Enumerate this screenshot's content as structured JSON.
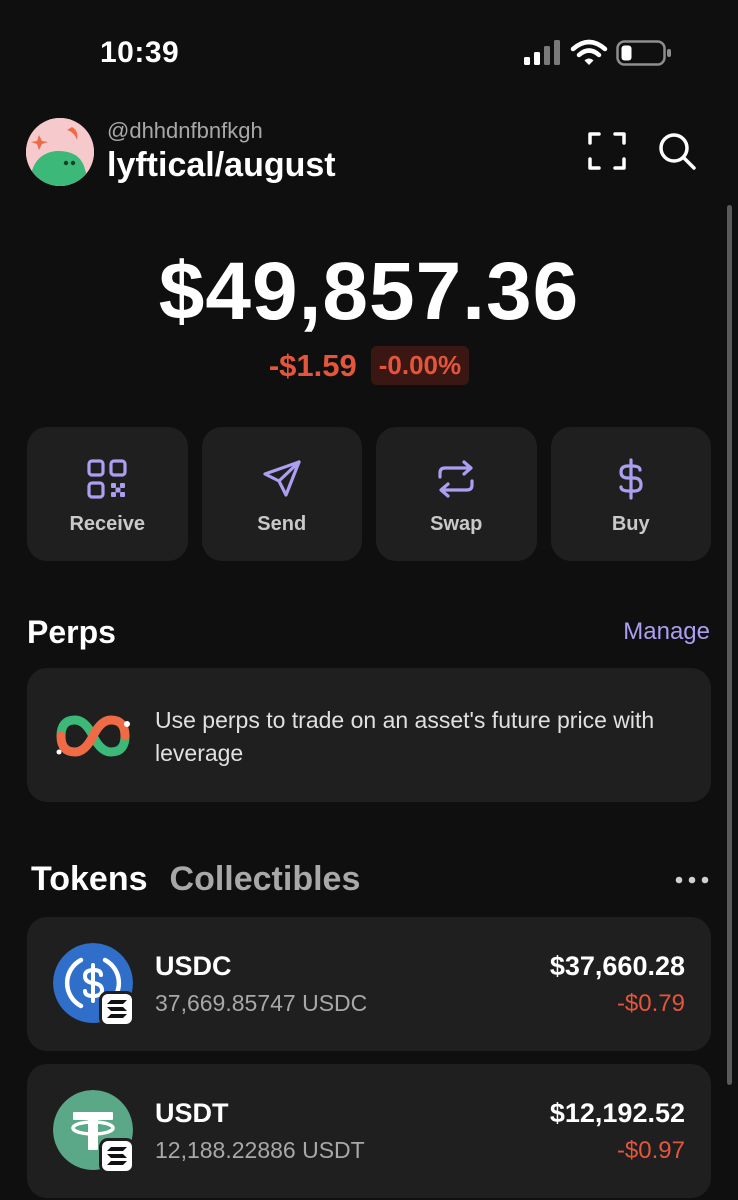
{
  "status_bar": {
    "time": "10:39",
    "signal_icon": "cellular-signal-icon",
    "wifi_icon": "wifi-icon",
    "battery_icon": "battery-low-icon"
  },
  "header": {
    "handle": "@dhhdnfbnfkgh",
    "account_name": "lyftical/august",
    "avatar_icon": "avatar-icon",
    "expand_icon": "expand-frame-icon",
    "search_icon": "search-icon"
  },
  "balance": {
    "total": "$49,857.36",
    "change_value": "-$1.59",
    "change_percent": "-0.00%"
  },
  "actions": [
    {
      "label": "Receive",
      "icon": "qr-code-icon"
    },
    {
      "label": "Send",
      "icon": "send-arrow-icon"
    },
    {
      "label": "Swap",
      "icon": "swap-arrows-icon"
    },
    {
      "label": "Buy",
      "icon": "dollar-icon"
    }
  ],
  "perps": {
    "title": "Perps",
    "manage_label": "Manage",
    "description": "Use perps to trade on an asset's future price with leverage",
    "icon": "perps-infinity-icon"
  },
  "tabs": {
    "tokens": "Tokens",
    "collectibles": "Collectibles",
    "more_icon": "more-dots-icon"
  },
  "tokens": [
    {
      "name": "USDC",
      "amount": "37,669.85747 USDC",
      "value": "$37,660.28",
      "change": "-$0.79",
      "logo": "usdc-logo-icon",
      "badge": "solana-badge-icon"
    },
    {
      "name": "USDT",
      "amount": "12,188.22886 USDT",
      "value": "$12,192.52",
      "change": "-$0.97",
      "logo": "usdt-logo-icon",
      "badge": "solana-badge-icon"
    }
  ],
  "colors": {
    "background": "#0f0f0f",
    "card": "#1f1f1f",
    "accent": "#ab9ff2",
    "negative": "#e5553b"
  }
}
